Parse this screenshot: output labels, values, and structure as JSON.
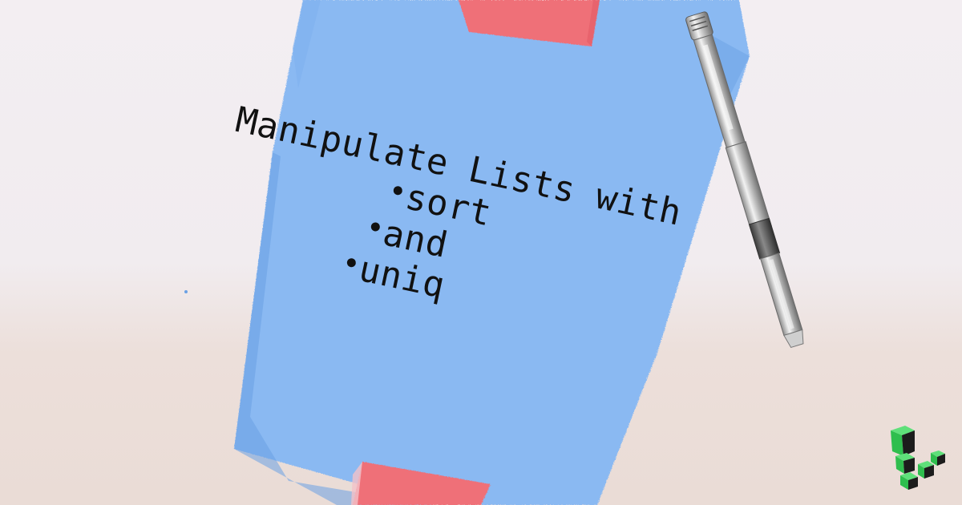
{
  "note": {
    "title_line_1": "Manipulate Lists with",
    "items": [
      "sort",
      "and",
      "uniq"
    ]
  },
  "colors": {
    "background_top": "#f3eef2",
    "background_bottom": "#eadcd6",
    "paper": "#8ab9f2",
    "paper_edge": "#5f95dc",
    "tape": "#ef6f78",
    "ink": "#111111",
    "logo_green": "#2fbe4e",
    "logo_dark": "#1c1c1c"
  },
  "icons": {
    "pen": "pen-icon",
    "logo": "linode-logo-icon"
  }
}
